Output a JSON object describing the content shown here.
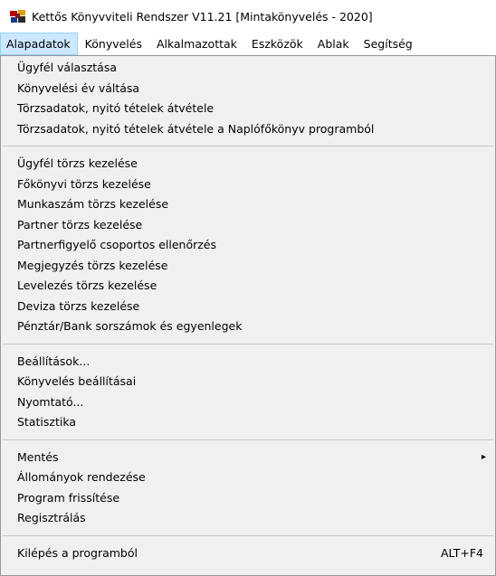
{
  "window": {
    "title": "Kettős Könyvviteli Rendszer V11.21 [Mintakönyvelés - 2020]",
    "icon": "app-icon"
  },
  "menubar": {
    "items": [
      "Alapadatok",
      "Könyvelés",
      "Alkalmazottak",
      "Eszközök",
      "Ablak",
      "Segítség"
    ],
    "active": "Alapadatok"
  },
  "menu": {
    "groups": [
      [
        "Ügyfél választása",
        "Könyvelési év váltása",
        "Törzsadatok, nyitó tételek átvétele",
        "Törzsadatok, nyitó tételek átvétele a Naplófőkönyv programból"
      ],
      [
        "Ügyfél törzs kezelése",
        "Főkönyvi törzs kezelése",
        "Munkaszám törzs kezelése",
        "Partner törzs kezelése",
        "Partnerfigyelő csoportos ellenőrzés",
        "Megjegyzés törzs kezelése",
        "Levelezés törzs kezelése",
        "Deviza törzs kezelése",
        "Pénztár/Bank sorszámok és egyenlegek"
      ],
      [
        "Beállítások...",
        "Könyvelés beállításai",
        "Nyomtató...",
        "Statisztika"
      ],
      [
        "Mentés",
        "Állományok rendezése",
        "Program frissítése",
        "Regisztrálás"
      ],
      [
        "Kilépés a programból"
      ]
    ],
    "exit_shortcut": "ALT+F4",
    "submenu_arrow": "▸"
  },
  "colors": {
    "menu_bg": "#f0f0f0",
    "active_menu_bg": "#cce8ff"
  }
}
